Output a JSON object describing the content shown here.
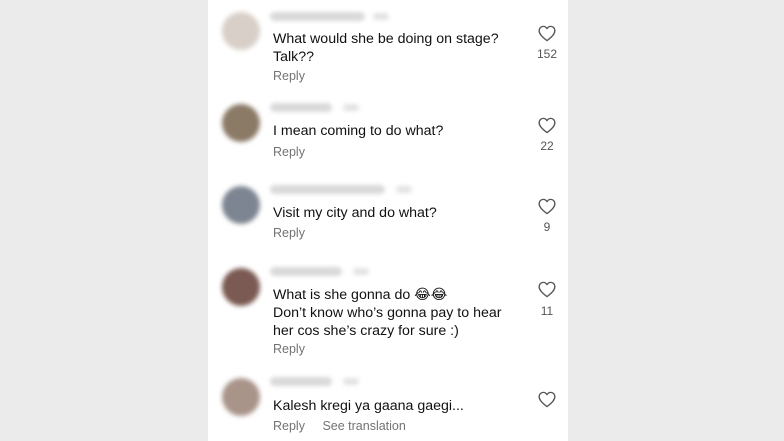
{
  "comments": [
    {
      "text": "What would she be doing on stage?\nTalk??",
      "likes": "152",
      "reply_label": "Reply",
      "avatar_color": "#d8cfc8"
    },
    {
      "text": "I mean coming to do what?",
      "likes": "22",
      "reply_label": "Reply",
      "avatar_color": "#8a7a66"
    },
    {
      "text": "Visit my city and do what?",
      "likes": "9",
      "reply_label": "Reply",
      "avatar_color": "#7d8592"
    },
    {
      "text": "What is she gonna do 😂😂\nDon’t know who’s gonna pay to hear\nher cos she’s crazy for sure :)",
      "likes": "11",
      "reply_label": "Reply",
      "avatar_color": "#7a5a52"
    },
    {
      "text": "Kalesh kregi ya gaana gaegi...",
      "likes": "",
      "reply_label": "Reply",
      "see_translation_label": "See translation",
      "avatar_color": "#a9948a"
    }
  ],
  "icons": {
    "like": "heart-outline-icon"
  },
  "colors": {
    "background": "#ebebeb",
    "panel": "#ffffff",
    "text": "#111111",
    "meta": "#737373"
  }
}
